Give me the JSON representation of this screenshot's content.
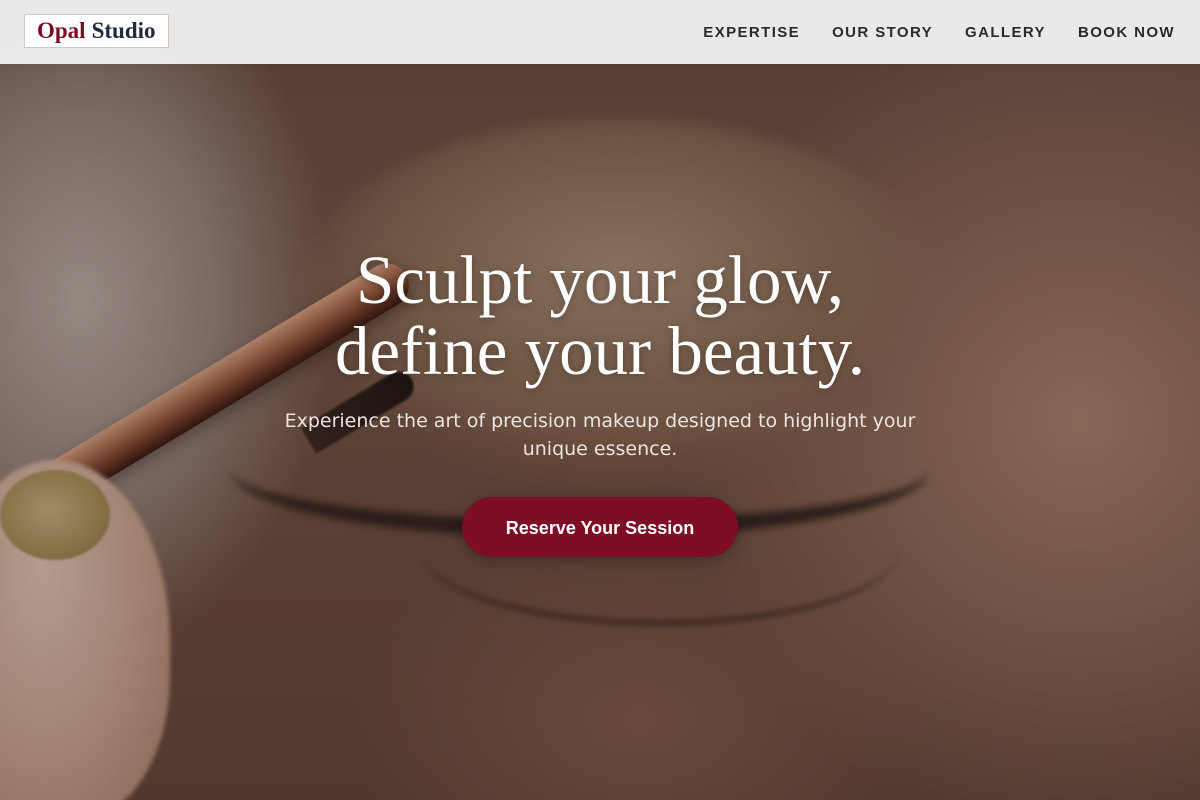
{
  "brand": {
    "name_part1": "Opal",
    "name_part2": "Studio",
    "colors": {
      "primary": "#7d0e26",
      "dark": "#232a3f",
      "header_bg": "#f0eeed"
    }
  },
  "nav": {
    "items": [
      {
        "label": "EXPERTISE"
      },
      {
        "label": "OUR STORY"
      },
      {
        "label": "GALLERY"
      },
      {
        "label": "BOOK NOW"
      }
    ]
  },
  "hero": {
    "headline_line1": "Sculpt your glow,",
    "headline_line2": "define your beauty.",
    "subtitle": "Experience the art of precision makeup designed to highlight your unique essence.",
    "cta_label": "Reserve Your Session",
    "background_image": "close-up-eye-makeup-brush-photo"
  }
}
